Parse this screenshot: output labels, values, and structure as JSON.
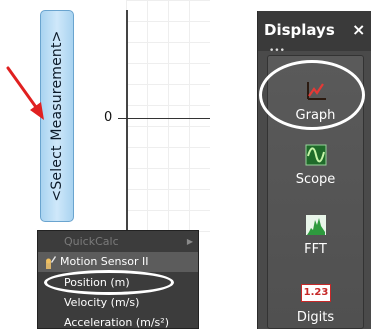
{
  "graph": {
    "select_measurement_label": "<Select Measurement>",
    "zero_tick_label": "0"
  },
  "menu": {
    "quickcalc_label": "QuickCalc",
    "sensor_label": "Motion Sensor II",
    "items": [
      {
        "label": "Position (m)"
      },
      {
        "label": "Velocity (m/s)"
      },
      {
        "label": "Acceleration (m/s²)"
      }
    ]
  },
  "displays": {
    "title": "Displays",
    "close_glyph": "×",
    "tiles": [
      {
        "label": "Graph",
        "icon": "graph-icon"
      },
      {
        "label": "Scope",
        "icon": "scope-icon"
      },
      {
        "label": "FFT",
        "icon": "fft-icon"
      },
      {
        "label": "Digits",
        "icon": "digits-icon",
        "badge": "1.23"
      }
    ]
  },
  "colors": {
    "select_button": "#bfe0f7",
    "annotation_arrow": "#e02020",
    "palette_bg": "#4a4a4a",
    "menu_bg": "#3c3c3c"
  }
}
